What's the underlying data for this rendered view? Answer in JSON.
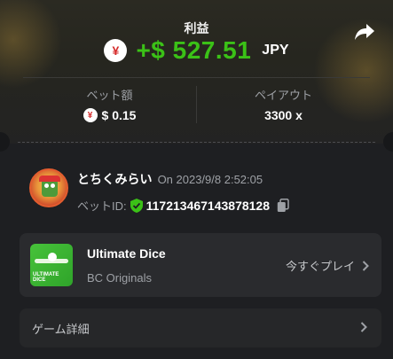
{
  "header": {
    "title": "利益",
    "profit_value": "+$ 527.51",
    "currency": "JPY",
    "currency_symbol": "¥"
  },
  "stats": {
    "bet_label": "ベット額",
    "bet_value": "$ 0.15",
    "payout_label": "ペイアウト",
    "payout_value": "3300 x"
  },
  "user": {
    "name": "とちくみらい",
    "datetime": "On 2023/9/8 2:52:05",
    "bet_id_label": "ベットID:",
    "bet_id": "117213467143878128"
  },
  "game": {
    "name": "Ultimate Dice",
    "provider": "BC Originals",
    "play_label": "今すぐプレイ",
    "thumb_text": "ULTIMATE DICE"
  },
  "details": {
    "label": "ゲーム詳細"
  },
  "colors": {
    "profit_green": "#3bc117",
    "background": "#1e1f22",
    "card": "#2a2b2e"
  },
  "icons": [
    "share-icon",
    "yen-icon",
    "shield-check-icon",
    "copy-icon",
    "chevron-right-icon"
  ]
}
